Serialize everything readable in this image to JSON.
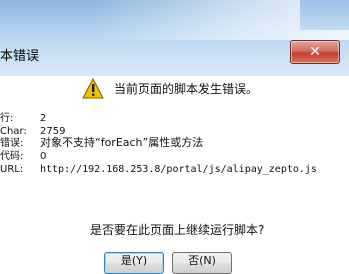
{
  "window": {
    "title": "本错误",
    "close_symbol": "✕"
  },
  "dialog": {
    "header_message": "当前页面的脚本发生错误。",
    "fields": [
      {
        "label": "行:",
        "value": "2"
      },
      {
        "label": "Char:",
        "value": "2759"
      },
      {
        "label": "错误:",
        "value": "对象不支持“forEach”属性或方法"
      },
      {
        "label": "代码:",
        "value": "0"
      },
      {
        "label": "URL:",
        "value": "http://192.168.253.8/portal/js/alipay_zepto.js"
      }
    ],
    "question": "是否要在此页面上继续运行脚本?",
    "buttons": {
      "yes_label": "是(Y)",
      "no_label": "否(N)"
    }
  },
  "icons": {
    "warning": "warning-triangle-icon"
  }
}
